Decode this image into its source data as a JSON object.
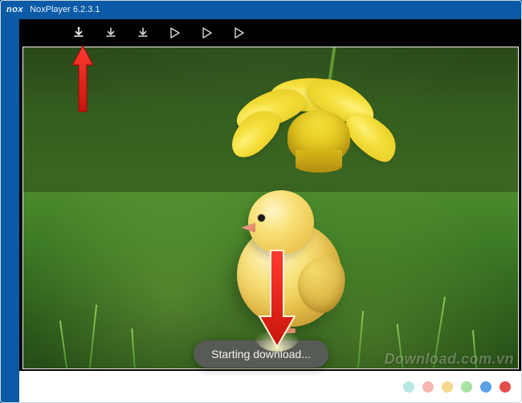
{
  "titlebar": {
    "logo_text": "nox",
    "title": "NoxPlayer 6.2.3.1"
  },
  "toolbar": {
    "icons": [
      {
        "name": "download",
        "highlighted": true
      },
      {
        "name": "download"
      },
      {
        "name": "download"
      },
      {
        "name": "play-store"
      },
      {
        "name": "play-store"
      },
      {
        "name": "play-store"
      }
    ]
  },
  "toast": {
    "text": "Starting download..."
  },
  "watermark": {
    "text": "Download.com.vn"
  },
  "bottom_dots": [
    {
      "color": "#b8e8e4"
    },
    {
      "color": "#f6b7b1"
    },
    {
      "color": "#f4d88c"
    },
    {
      "color": "#a7e3a3"
    },
    {
      "color": "#5aa1e6"
    },
    {
      "color": "#e44b4b"
    }
  ]
}
